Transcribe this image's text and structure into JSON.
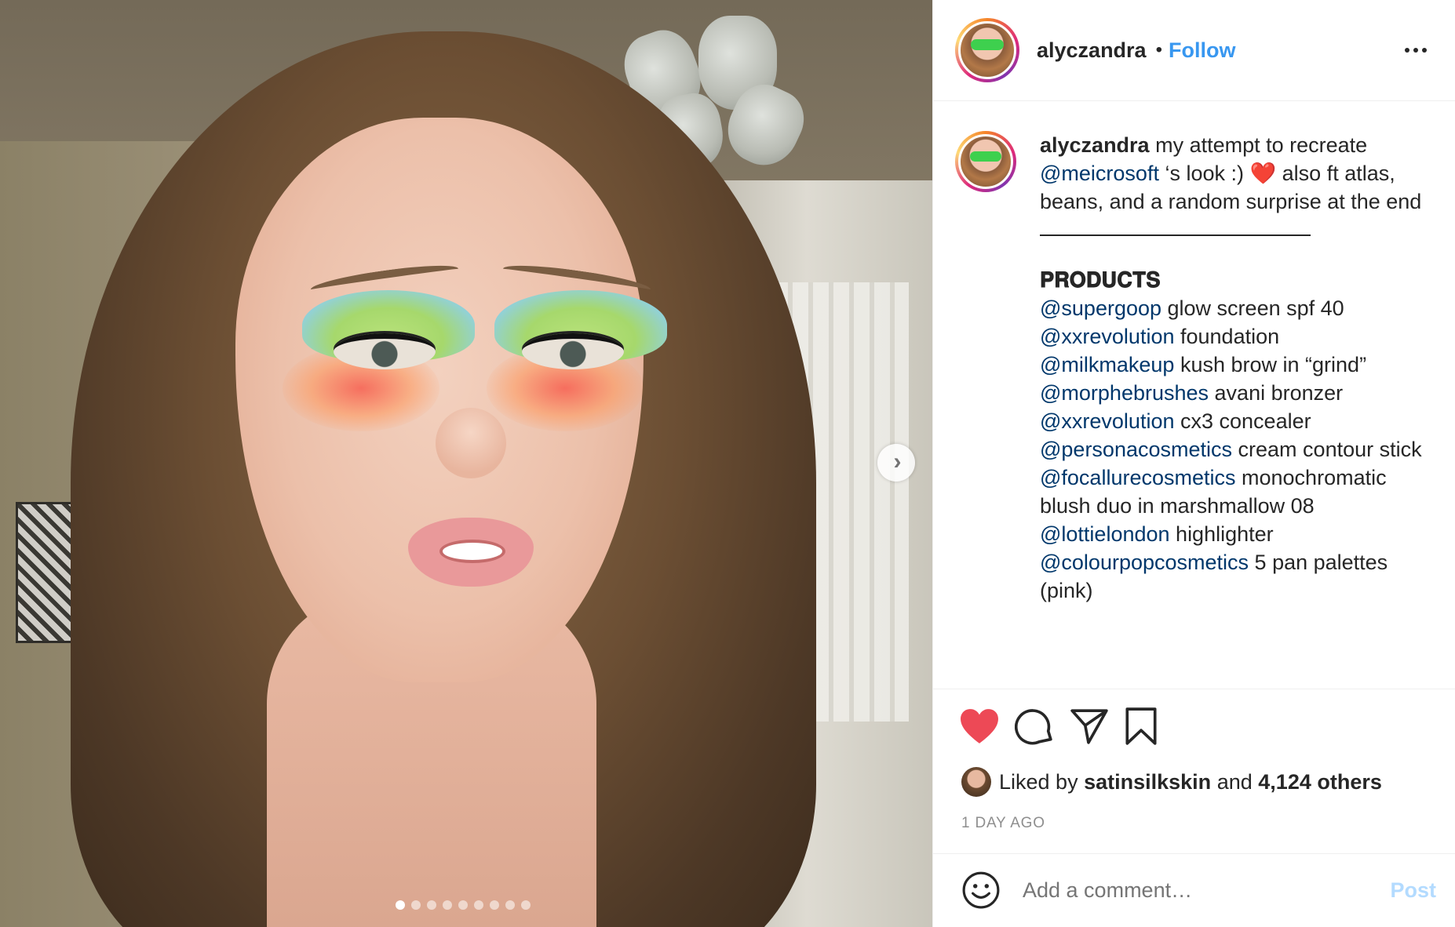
{
  "header": {
    "username": "alyczandra",
    "separator": "•",
    "follow_label": "Follow"
  },
  "caption": {
    "username": "alyczandra",
    "text_1": "my attempt to recreate",
    "mention_1": "@meicrosoft",
    "text_2": "‘s look :)",
    "heart": "❤️",
    "text_3": "also ft atlas, beans, and a random surprise at the end",
    "products_heading": "𝐏𝐑𝐎𝐃𝐔𝐂𝐓𝐒",
    "products": [
      {
        "mention": "@supergoop",
        "text": "glow screen spf 40"
      },
      {
        "mention": "@xxrevolution",
        "text": "foundation"
      },
      {
        "mention": "@milkmakeup",
        "text": "kush brow in “grind”"
      },
      {
        "mention": "@morphebrushes",
        "text": "avani bronzer"
      },
      {
        "mention": "@xxrevolution",
        "text": "cx3 concealer"
      },
      {
        "mention": "@personacosmetics",
        "text": "cream contour stick"
      },
      {
        "mention": "@focallurecosmetics",
        "text": "monochromatic blush duo in marshmallow 08"
      },
      {
        "mention": "@lottielondon",
        "text": "highlighter"
      },
      {
        "mention": "@colourpopcosmetics",
        "text": "5 pan palettes (pink)"
      }
    ]
  },
  "likes": {
    "prefix": "Liked by",
    "user": "satinsilkskin",
    "and": "and",
    "others": "4,124 others"
  },
  "timestamp": "1 DAY AGO",
  "comment": {
    "placeholder": "Add a comment…",
    "post_label": "Post"
  },
  "carousel": {
    "slide_count": 9,
    "active_index": 0
  },
  "icons": {
    "like": "heart-filled-icon",
    "comment": "comment-bubble-icon",
    "share": "paper-plane-icon",
    "save": "bookmark-icon",
    "emoji": "smiley-icon",
    "more": "more-horizontal-icon",
    "next": "chevron-right-icon"
  },
  "colors": {
    "accent_blue": "#3897f0",
    "mention_blue": "#00376b",
    "like_red": "#ed4956",
    "post_disabled": "#b3dbff",
    "meta_gray": "#8e8e8e"
  }
}
